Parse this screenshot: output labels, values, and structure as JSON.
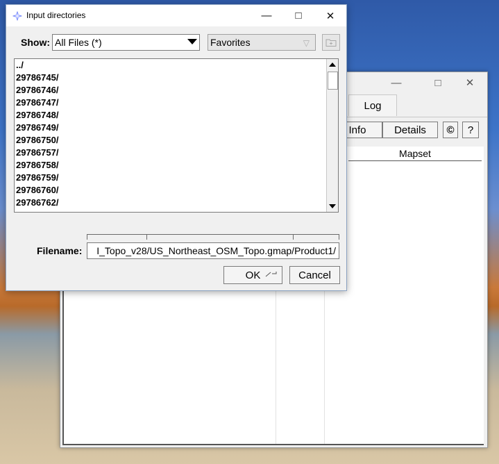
{
  "background_window": {
    "tab_log": "Log",
    "info_button": "Info",
    "details_button": "Details",
    "copyright_button": "©",
    "help_button": "?",
    "column_mapset": "Mapset"
  },
  "dialog": {
    "title": "Input directories",
    "show_label": "Show:",
    "filter_value": "All Files (*)",
    "favorites_label": "Favorites",
    "directory_items": [
      "../",
      "29786745/",
      "29786746/",
      "29786747/",
      "29786748/",
      "29786749/",
      "29786750/",
      "29786757/",
      "29786758/",
      "29786759/",
      "29786760/",
      "29786762/"
    ],
    "filename_label": "Filename:",
    "filename_value": "I_Topo_v28/US_Northeast_OSM_Topo.gmap/Product1/",
    "ok_button": "OK",
    "cancel_button": "Cancel"
  },
  "icons": {
    "app": "grass-diamond-icon",
    "new_folder": "new-folder-icon"
  }
}
